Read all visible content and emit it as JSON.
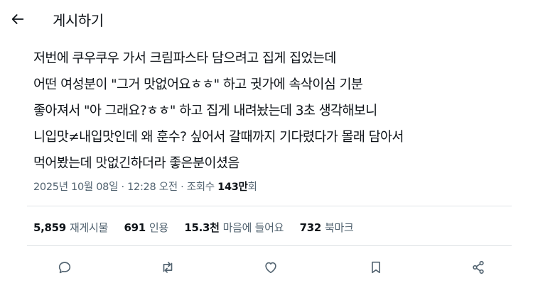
{
  "header": {
    "back_icon": "arrow-left-icon",
    "title": "게시하기"
  },
  "tweet": {
    "lines": [
      "저번에 쿠우쿠우 가서 크림파스타 담으려고 집게 집었는데",
      "어떤 여성분이 \"그거 맛없어요ㅎㅎ\" 하고 귓가에 속삭이심 기분",
      "좋아져서 \"아 그래요?ㅎㅎ\" 하고 집게 내려놨는데 3초 생각해보니",
      "니입맛≠내입맛인데 왜 훈수? 싶어서 갈때까지 기다렸다가 몰래 담아서",
      "먹어봤는데 맛없긴하더라 좋은분이셨음"
    ]
  },
  "meta": {
    "date": "2025년 10월 08일",
    "sep1": " · ",
    "time": "12:28 오전",
    "sep2": " · ",
    "views_label": "조회수 ",
    "views_count": "143만",
    "views_suffix": "회"
  },
  "stats": {
    "reposts": {
      "num": "5,859",
      "label": "재게시물"
    },
    "quotes": {
      "num": "691",
      "label": "인용"
    },
    "likes": {
      "num": "15.3천",
      "label": "마음에 들어요"
    },
    "bookmarks": {
      "num": "732",
      "label": "북마크"
    }
  },
  "actions": {
    "reply_icon": "reply-icon",
    "retweet_icon": "retweet-icon",
    "like_icon": "heart-icon",
    "bookmark_icon": "bookmark-icon",
    "share_icon": "share-icon"
  },
  "colors": {
    "text_primary": "#0f1419",
    "text_secondary": "#536471",
    "divider": "#dfe3e6"
  }
}
